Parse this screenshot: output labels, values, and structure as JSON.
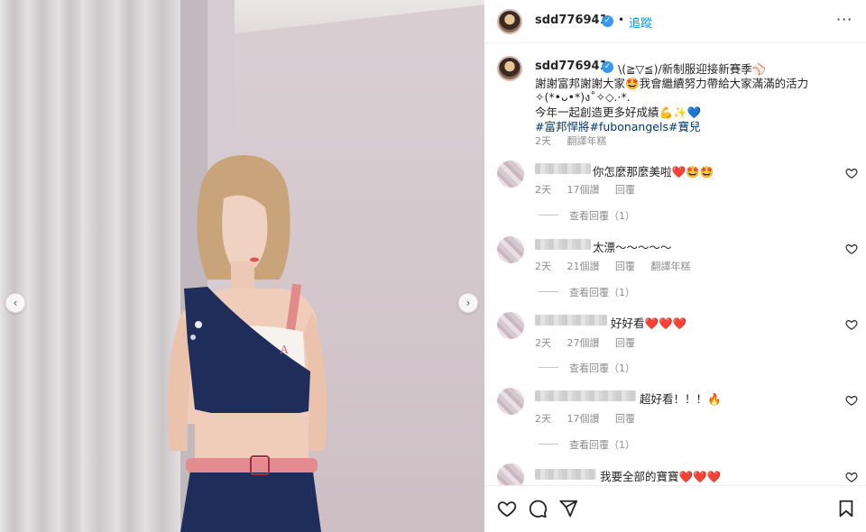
{
  "post": {
    "username": "sdd776941",
    "follow_label": "追蹤",
    "separator": "•",
    "more_label": "···"
  },
  "caption": {
    "username": "sdd776941",
    "line1": "\\(≧▽≦)/新制服迎接新賽季⚾",
    "line2": "謝謝富邦謝謝大家🤩我會繼續努力帶給大家滿滿的活力",
    "line3": "✧(*•ᴗ•*)ง˚✧◇.·*.",
    "line4": "今年一起創造更多好成績💪✨💙",
    "hashtags": "#富邦悍將#fubonangels#寶兒",
    "time": "2天",
    "translate": "翻譯年糕"
  },
  "comments": [
    {
      "text": "你怎麼那麼美啦❤️🤩🤩",
      "time": "2天",
      "likes": "17個讚",
      "reply": "回覆",
      "translate": "",
      "view_replies": "查看回覆（1）"
    },
    {
      "text": "太漂～～～～～",
      "time": "2天",
      "likes": "21個讚",
      "reply": "回覆",
      "translate": "翻譯年糕",
      "view_replies": "查看回覆（1）"
    },
    {
      "text": "好好看❤️❤️❤️",
      "time": "2天",
      "likes": "27個讚",
      "reply": "回覆",
      "translate": "",
      "view_replies": "查看回覆（1）"
    },
    {
      "text": "超好看！！！🔥",
      "time": "2天",
      "likes": "17個讚",
      "reply": "回覆",
      "translate": "",
      "view_replies": "查看回覆（1）"
    },
    {
      "text": "我要全部的寶寶❤️❤️❤️",
      "time": "",
      "likes": "",
      "reply": "",
      "translate": "",
      "view_replies": ""
    }
  ],
  "carousel": {
    "prev_icon": "chevron-left-icon",
    "next_icon": "chevron-right-icon"
  },
  "colors": {
    "link": "#0095f6",
    "hashtag": "#00376b",
    "verified": "#3897f0",
    "meta": "#8e8e8e",
    "heart_red": "#ed4956"
  }
}
